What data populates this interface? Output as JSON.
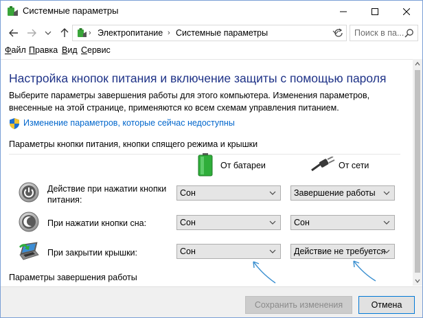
{
  "window": {
    "title": "Системные параметры",
    "controls": {
      "minimize": "minimize",
      "maximize": "maximize",
      "close": "close"
    }
  },
  "address": {
    "crumbs": [
      "Электропитание",
      "Системные параметры"
    ],
    "search_placeholder": "Поиск в па..."
  },
  "menu": {
    "items": [
      {
        "label": "Файл",
        "underline": "Ф",
        "rest": "айл"
      },
      {
        "label": "Правка",
        "underline": "П",
        "rest": "равка"
      },
      {
        "label": "Вид",
        "underline": "В",
        "rest": "ид"
      },
      {
        "label": "Сервис",
        "underline": "С",
        "rest": "ервис"
      }
    ]
  },
  "main": {
    "heading": "Настройка кнопок питания и включение защиты с помощью пароля",
    "description": "Выберите параметры завершения работы для этого компьютера. Изменения параметров, внесенные на этой странице, применяются ко всем схемам управления питанием.",
    "change_link": "Изменение параметров, которые сейчас недоступны",
    "section_title": "Параметры кнопки питания, кнопки спящего режима и крышки",
    "columns": {
      "battery": "От батареи",
      "ac": "От сети"
    },
    "rows": [
      {
        "label": "Действие при нажатии кнопки питания:",
        "battery": "Сон",
        "ac": "Завершение работы"
      },
      {
        "label": "При нажатии кнопки сна:",
        "battery": "Сон",
        "ac": "Сон"
      },
      {
        "label": "При закрытии крышки:",
        "battery": "Сон",
        "ac": "Действие не требуется"
      }
    ],
    "section2_title": "Параметры завершения работы"
  },
  "footer": {
    "save": "Сохранить изменения",
    "cancel": "Отмена"
  },
  "colors": {
    "heading": "#1e3287",
    "link": "#0066cc",
    "annotation_arrow": "#3a8fd0"
  }
}
